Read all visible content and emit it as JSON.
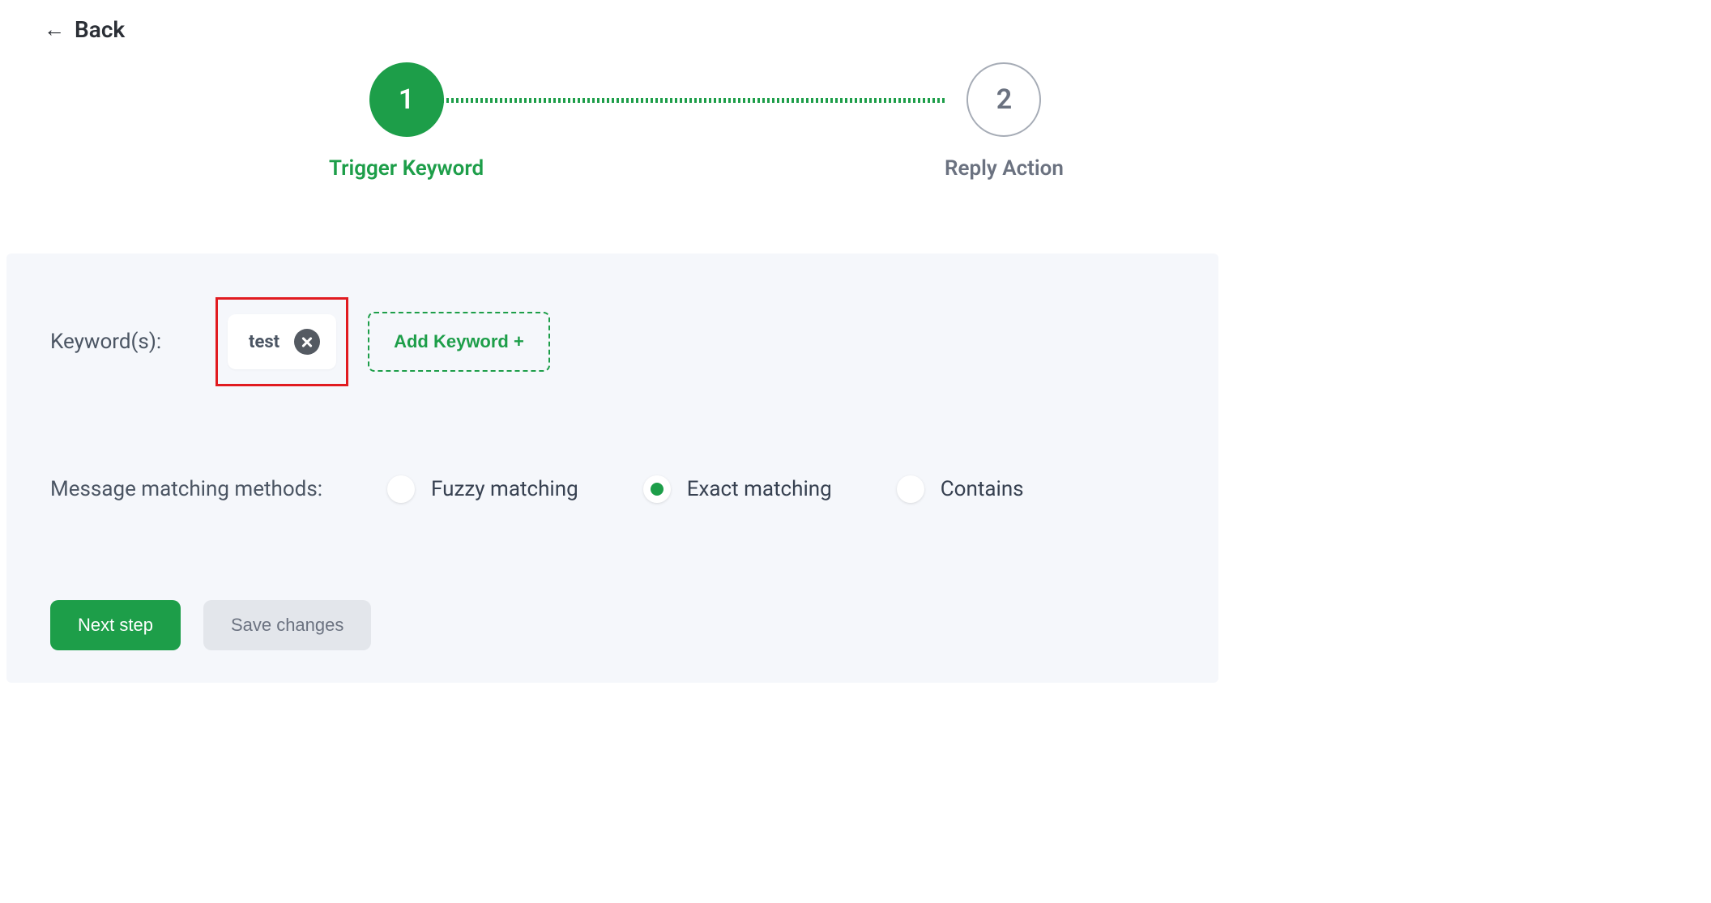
{
  "back": {
    "label": "Back"
  },
  "stepper": {
    "steps": [
      {
        "num": "1",
        "label": "Trigger Keyword",
        "active": true
      },
      {
        "num": "2",
        "label": "Reply Action",
        "active": false
      }
    ]
  },
  "keywords": {
    "section_label": "Keyword(s):",
    "items": [
      {
        "text": "test"
      }
    ],
    "add_label": "Add Keyword +"
  },
  "matching": {
    "section_label": "Message matching methods:",
    "options": [
      {
        "label": "Fuzzy matching",
        "selected": false
      },
      {
        "label": "Exact matching",
        "selected": true
      },
      {
        "label": "Contains",
        "selected": false
      }
    ]
  },
  "actions": {
    "next_label": "Next step",
    "save_label": "Save changes"
  }
}
